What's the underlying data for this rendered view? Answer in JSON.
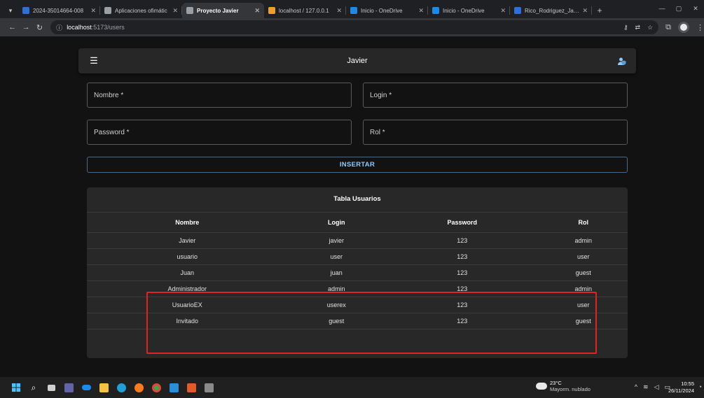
{
  "browser": {
    "tabs": [
      {
        "title": "2024-35014664-008",
        "color": "#2f6fd8",
        "active": false
      },
      {
        "title": "Aplicaciones ofimátic",
        "color": "#9aa0a6",
        "active": false
      },
      {
        "title": "Proyecto Javier",
        "color": "#9aa0a6",
        "active": true
      },
      {
        "title": "localhost / 127.0.0.1",
        "color": "#f0a020",
        "active": false
      },
      {
        "title": "Inicio - OneDrive",
        "color": "#1c8ae8",
        "active": false
      },
      {
        "title": "Inicio - OneDrive",
        "color": "#1c8ae8",
        "active": false
      },
      {
        "title": "Rico_Rodriguez_Javie",
        "color": "#2f6fd8",
        "active": false
      }
    ],
    "url_host": "localhost",
    "url_path": ":5173/users"
  },
  "app": {
    "title": "Javier",
    "form": {
      "nombre_label": "Nombre *",
      "login_label": "Login *",
      "password_label": "Password *",
      "rol_label": "Rol *",
      "insert_button": "INSERTAR"
    },
    "table": {
      "title": "Tabla Usuarios",
      "headers": [
        "Nombre",
        "Login",
        "Password",
        "Rol"
      ],
      "rows": [
        [
          "Javier",
          "javier",
          "123",
          "admin"
        ],
        [
          "usuario",
          "user",
          "123",
          "user"
        ],
        [
          "Juan",
          "juan",
          "123",
          "guest"
        ],
        [
          "Administrador",
          "admin",
          "123",
          "admin"
        ],
        [
          "UsuarioEX",
          "userex",
          "123",
          "user"
        ],
        [
          "Invitado",
          "guest",
          "123",
          "guest"
        ]
      ]
    }
  },
  "taskbar": {
    "weather_temp": "23°C",
    "weather_desc": "Mayorm. nublado",
    "time": "10:55",
    "date": "26/11/2024"
  }
}
